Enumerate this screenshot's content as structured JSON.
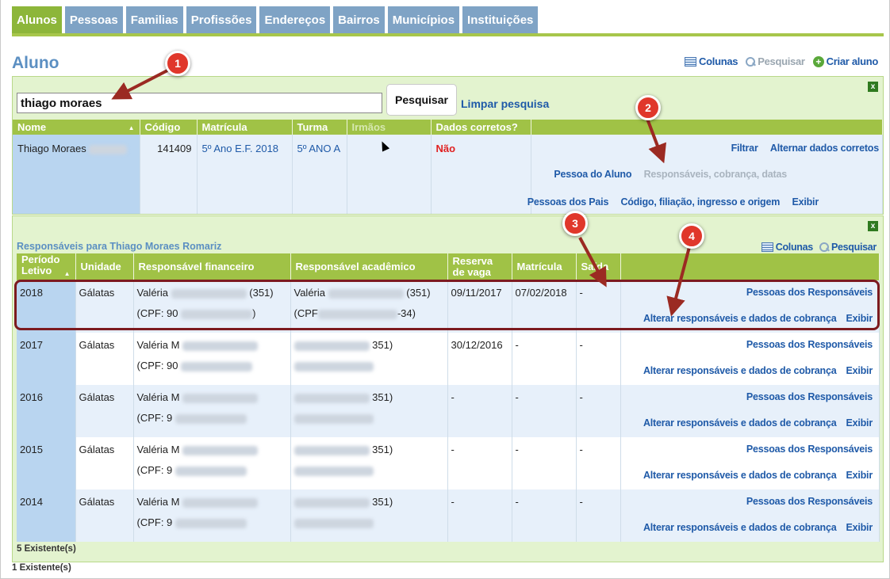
{
  "tabs": [
    "Alunos",
    "Pessoas",
    "Familias",
    "Profissões",
    "Endereços",
    "Bairros",
    "Municípios",
    "Instituições"
  ],
  "page_title": "Aluno",
  "top_actions": {
    "columns": "Colunas",
    "search": "Pesquisar",
    "create": "Criar aluno"
  },
  "search": {
    "value": "thiago moraes",
    "button": "Pesquisar",
    "clear": "Limpar pesquisa"
  },
  "close_label": "x",
  "students_table": {
    "headers": [
      "Nome",
      "Código",
      "Matrícula",
      "Turma",
      "Irmãos",
      "Dados corretos?"
    ],
    "row": {
      "name": "Thiago Moraes",
      "code": "141409",
      "enrollment": "5º Ano E.F. 2018",
      "class": "5º ANO A",
      "siblings": "",
      "correct": "Não"
    },
    "actions": {
      "filter": "Filtrar",
      "toggle": "Alternar dados corretos",
      "person": "Pessoa do Aluno",
      "responsibles": "Responsáveis, cobrança, datas",
      "parents": "Pessoas dos Pais",
      "code_info": "Código, filiação, ingresso e origem",
      "show": "Exibir"
    }
  },
  "responsibles": {
    "title": "Responsáveis para Thiago Moraes Romariz",
    "columns": "Colunas",
    "search": "Pesquisar",
    "headers": [
      "Período Letivo",
      "Unidade",
      "Responsável financeiro",
      "Responsável acadêmico",
      "Reserva de vaga",
      "Matrícula",
      "Saída"
    ],
    "rows": [
      {
        "year": "2018",
        "unit": "Gálatas",
        "fin_name": "Valéria",
        "fin_tail": "(351)",
        "fin_cpf": "(CPF: 90",
        "fin_cpf_tail": ")",
        "acad_name": "Valéria",
        "acad_tail": "(351)",
        "acad_cpf": "(CPF",
        "acad_cpf_tail": "-34)",
        "reserve": "09/11/2017",
        "enroll": "07/02/2018",
        "exit": "-"
      },
      {
        "year": "2017",
        "unit": "Gálatas",
        "fin_name": "Valéria M",
        "fin_tail": "",
        "fin_cpf": "(CPF: 90",
        "fin_cpf_tail": "",
        "acad_name": "",
        "acad_tail": "351)",
        "acad_cpf": "",
        "acad_cpf_tail": "",
        "reserve": "30/12/2016",
        "enroll": "-",
        "exit": "-"
      },
      {
        "year": "2016",
        "unit": "Gálatas",
        "fin_name": "Valéria M",
        "fin_tail": "",
        "fin_cpf": "(CPF: 9",
        "fin_cpf_tail": "",
        "acad_name": "",
        "acad_tail": "351)",
        "acad_cpf": "",
        "acad_cpf_tail": "",
        "reserve": "-",
        "enroll": "-",
        "exit": "-"
      },
      {
        "year": "2015",
        "unit": "Gálatas",
        "fin_name": "Valéria M",
        "fin_tail": "",
        "fin_cpf": "(CPF: 9",
        "fin_cpf_tail": "",
        "acad_name": "",
        "acad_tail": "351)",
        "acad_cpf": "",
        "acad_cpf_tail": "",
        "reserve": "-",
        "enroll": "-",
        "exit": "-"
      },
      {
        "year": "2014",
        "unit": "Gálatas",
        "fin_name": "Valéria M",
        "fin_tail": "",
        "fin_cpf": "(CPF: 9",
        "fin_cpf_tail": "",
        "acad_name": "",
        "acad_tail": "351)",
        "acad_cpf": "",
        "acad_cpf_tail": "",
        "reserve": "-",
        "enroll": "-",
        "exit": "-"
      }
    ],
    "row_actions": {
      "persons": "Pessoas dos Responsáveis",
      "change": "Alterar responsáveis e dados de cobrança",
      "show": "Exibir"
    },
    "count": "5 Existente(s)"
  },
  "count": "1 Existente(s)",
  "callouts": [
    "1",
    "2",
    "3",
    "4"
  ],
  "colors": {
    "tab_active": "#8db63a",
    "tab": "#7fa3c5",
    "header": "#a0c246",
    "link": "#1f5aa8",
    "alert": "#e02020",
    "callout": "#e0372b",
    "highlight": "#7c1a1f"
  }
}
